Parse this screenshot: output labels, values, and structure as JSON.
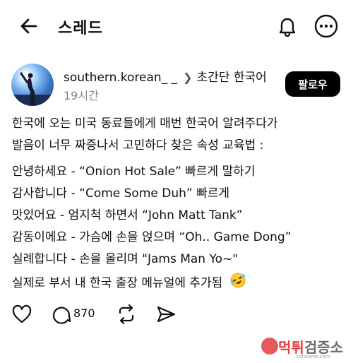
{
  "header": {
    "title": "스레드",
    "back_icon": "arrow-left-icon",
    "notification_icon": "bell-icon",
    "more_icon": "more-horizontal-icon"
  },
  "post": {
    "author": "southern.korean_ _",
    "topic": "초간단 한국어",
    "time": "19시간",
    "follow_label": "팔로우",
    "paragraph1": [
      "한국에 오는 미국 동료들에게 매번 한국어 알려주다가",
      "발음이 너무 짜증나서 고민하다 찾은 속성 교육법 :"
    ],
    "paragraph2": [
      "안녕하세요 - “Onion Hot Sale” 빠르게 말하기",
      "감사합니다 - “Come Some Duh” 빠르게",
      "맛있어요 - 엄지척 하면서 “John Matt Tank”",
      "감동이에요 - 가슴에 손을 얹으며 “Oh.. Game Dong”",
      "실례합니다 - 손을 올리며 \"Jams Man Yo~\""
    ],
    "paragraph3": "실제로 부서 내 한국 출장 메뉴얼에 추가됨",
    "emoji": "rolling-on-floor-laughing-emoji",
    "reply_count": "870"
  },
  "watermark": {
    "red_text": "먹튀",
    "grey_text": "검증소",
    "sub_text": "totosave.com"
  },
  "colors": {
    "background": "#ffffff",
    "text": "#111111",
    "muted": "#888888",
    "follow_bg": "#000000",
    "watermark_red": "#e63c3c"
  }
}
